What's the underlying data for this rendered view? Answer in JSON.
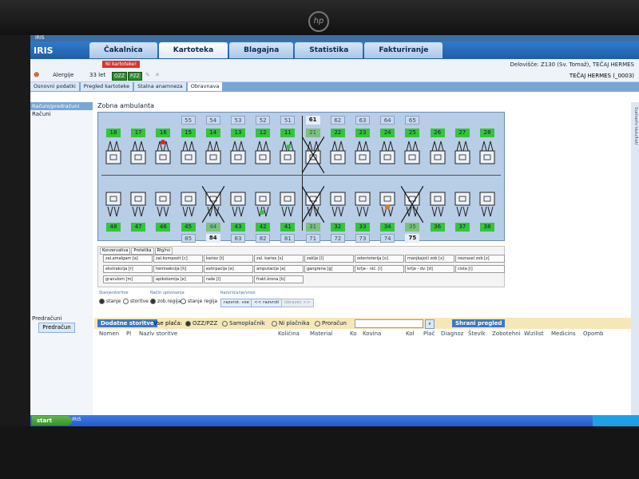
{
  "window": {
    "title": "IRIS"
  },
  "menu": {
    "brand": "IRIS",
    "tabs": [
      {
        "label": "Čakalnica",
        "active": false
      },
      {
        "label": "Kartoteka",
        "active": true
      },
      {
        "label": "Blagajna",
        "active": false
      },
      {
        "label": "Statistika",
        "active": false
      },
      {
        "label": "Fakturiranje",
        "active": false
      }
    ]
  },
  "info": {
    "ni_kartoteke": "Ni kartoteke!",
    "dentist": "Delovišče: Z130 (Sv. Tomaž), TEČAJ HERMES",
    "alergije": "Alergije",
    "age": "33 let",
    "badge1": "OZZ",
    "badge2": "PZZ",
    "patient": "TEČAJ HERMES (_0003)"
  },
  "subtabs": [
    {
      "label": "Osnovni podatki",
      "active": false
    },
    {
      "label": "Pregled kartoteke",
      "active": false
    },
    {
      "label": "Stalna anamneza",
      "active": false
    },
    {
      "label": "Obravnava",
      "active": true
    }
  ],
  "left": {
    "header": "Računi/predračuni",
    "item": "Računi",
    "pre_header": "Predračuni",
    "pre_btn": "Predračun"
  },
  "main": {
    "ambulanta": "Zobna ambulanta"
  },
  "teeth": {
    "upper_primary_left": [
      "55",
      "54",
      "53",
      "52",
      "51"
    ],
    "upper_primary_right": [
      "61",
      "62",
      "63",
      "64",
      "65"
    ],
    "upper_perm": [
      "18",
      "17",
      "16",
      "15",
      "14",
      "13",
      "12",
      "11",
      "21",
      "22",
      "23",
      "24",
      "25",
      "26",
      "27",
      "28"
    ],
    "lower_perm": [
      "48",
      "47",
      "46",
      "45",
      "44",
      "43",
      "42",
      "41",
      "31",
      "32",
      "33",
      "34",
      "35",
      "36",
      "37",
      "38"
    ],
    "lower_primary_left": [
      "85",
      "84",
      "83",
      "82",
      "81"
    ],
    "lower_primary_right": [
      "71",
      "72",
      "73",
      "74",
      "75"
    ]
  },
  "status_panel": {
    "tabs": [
      "Konzervativa",
      "Protetika",
      "Rtg/no"
    ],
    "buttons": [
      [
        "zal.amalgam [a]",
        "zal.kompozit [c]",
        "kariez [t]",
        "zal. karies [s]",
        "zalčje [l]",
        "odontoterija [o]",
        "manjkajoči zob [x]",
        "nezrasel zob [z]"
      ],
      [
        "ekstrakcija [r]",
        "hemisekcija [h]",
        "extirpacija [e]",
        "amputacija [a]",
        "gangrena [g]",
        "krlja - nič. [i]",
        "krlja - dv. [d]",
        "cista [i]"
      ],
      [
        "granulom [m]",
        "apikotomija [e]",
        "rade [l]",
        "frakt.krona [b]"
      ]
    ]
  },
  "options": {
    "stanje_label": "Stanje/storitve",
    "stanje_opts": [
      "stanje",
      "storitve"
    ],
    "nacin_label": "Način upisovanja",
    "nacin_opts": [
      "zob.regija",
      "stanje regija"
    ],
    "razvrst_label": "Razvrščanje/vnos",
    "razvrst_btns": [
      "razvrst. vse",
      "<< razvrsti",
      "obrazec >>"
    ]
  },
  "bottom": {
    "dodatne": "Dodatne storitve",
    "vse_placa": "Vse plača:",
    "radios": [
      "OZZ/PZZ",
      "Samoplačnik",
      "Ni plačnika",
      "Proračun"
    ],
    "shrani": "Shrani pregled"
  },
  "columns": [
    "Nomen",
    "Pl",
    "Naziv storitve",
    "Količina",
    "Material",
    "Ko",
    "Kovina",
    "Kol",
    "Plač",
    "Diagnoz",
    "Števlk",
    "Zobotehni",
    "Wizilist",
    "Medicins",
    "Opomb"
  ],
  "right_strip": {
    "label": "Sumarni rezultati"
  },
  "taskbar": {
    "start": "start",
    "item": "IRIS"
  },
  "colors": {
    "accent": "#2f7bc9",
    "tooth_ok": "#35c43a",
    "mark_red": "#e02020",
    "mark_orange": "#e07820"
  }
}
